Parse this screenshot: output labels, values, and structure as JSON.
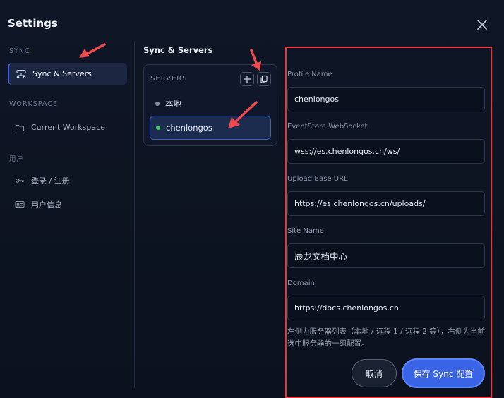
{
  "window": {
    "title": "Settings"
  },
  "sidebar": {
    "sections": [
      {
        "label": "SYNC",
        "items": [
          {
            "label": "Sync & Servers",
            "icon": "sync-servers-icon",
            "active": true
          }
        ]
      },
      {
        "label": "WORKSPACE",
        "items": [
          {
            "label": "Current Workspace",
            "icon": "folder-icon"
          }
        ]
      },
      {
        "label": "用户",
        "items": [
          {
            "label": "登录 / 注册",
            "icon": "key-icon"
          },
          {
            "label": "用户信息",
            "icon": "id-card-icon"
          }
        ]
      }
    ]
  },
  "servers": {
    "title": "Sync & Servers",
    "panel_label": "SERVERS",
    "items": [
      {
        "label": "本地",
        "status_color": "#8a8f9a",
        "selected": false
      },
      {
        "label": "chenlongos",
        "status_color": "#3ecf6b",
        "selected": true
      }
    ]
  },
  "form": {
    "profile_name": {
      "label": "Profile Name",
      "value": "chenlongos"
    },
    "ws": {
      "label": "EventStore WebSocket",
      "value": "wss://es.chenlongos.cn/ws/"
    },
    "upload": {
      "label": "Upload Base URL",
      "value": "https://es.chenlongos.cn/uploads/"
    },
    "site": {
      "label": "Site Name",
      "value": "辰龙文档中心"
    },
    "domain": {
      "label": "Domain",
      "value": "https://docs.chenlongos.cn"
    },
    "hint": "左侧为服务器列表（本地 / 远程 1 / 远程 2 等），右侧为当前选中服务器的一组配置。",
    "cancel_label": "取消",
    "save_label": "保存 Sync 配置"
  },
  "colors": {
    "accent": "#3a64e6",
    "annotation": "#e6373d",
    "online": "#3ecf6b"
  }
}
